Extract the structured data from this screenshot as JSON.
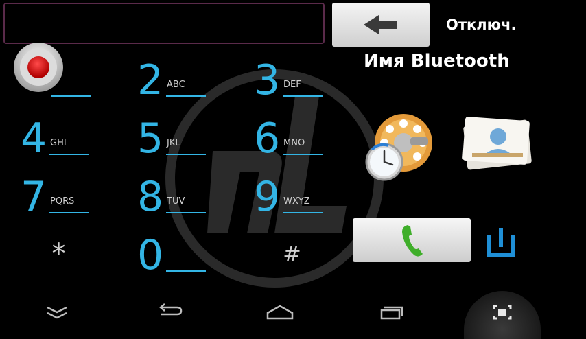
{
  "header": {
    "number_value": "",
    "status_text": "Отключ.",
    "bluetooth_name": "Имя Bluetooth"
  },
  "keypad": [
    {
      "digit": "2",
      "letters": "ABC"
    },
    {
      "digit": "3",
      "letters": "DEF"
    },
    {
      "digit": "4",
      "letters": "GHI"
    },
    {
      "digit": "5",
      "letters": "JKL"
    },
    {
      "digit": "6",
      "letters": "MNO"
    },
    {
      "digit": "7",
      "letters": "PQRS"
    },
    {
      "digit": "8",
      "letters": "TUV"
    },
    {
      "digit": "9",
      "letters": "WXYZ"
    },
    {
      "digit": "*",
      "letters": ""
    },
    {
      "digit": "0",
      "letters": ""
    },
    {
      "digit": "#",
      "letters": ""
    }
  ],
  "colors": {
    "accent": "#33b5e5",
    "call_green": "#3fae2a",
    "record_red": "#e00000"
  },
  "icons": {
    "backspace": "arrow-left-icon",
    "record": "record-icon",
    "dial_history": "rotary-dial-clock-icon",
    "contacts": "contacts-card-icon",
    "call": "phone-handset-icon",
    "power": "power-icon",
    "nav_hide": "chevron-double-down-icon",
    "nav_back": "back-icon",
    "nav_home": "home-icon",
    "nav_recent": "recent-apps-icon",
    "nav_fullscreen": "fullscreen-icon"
  }
}
